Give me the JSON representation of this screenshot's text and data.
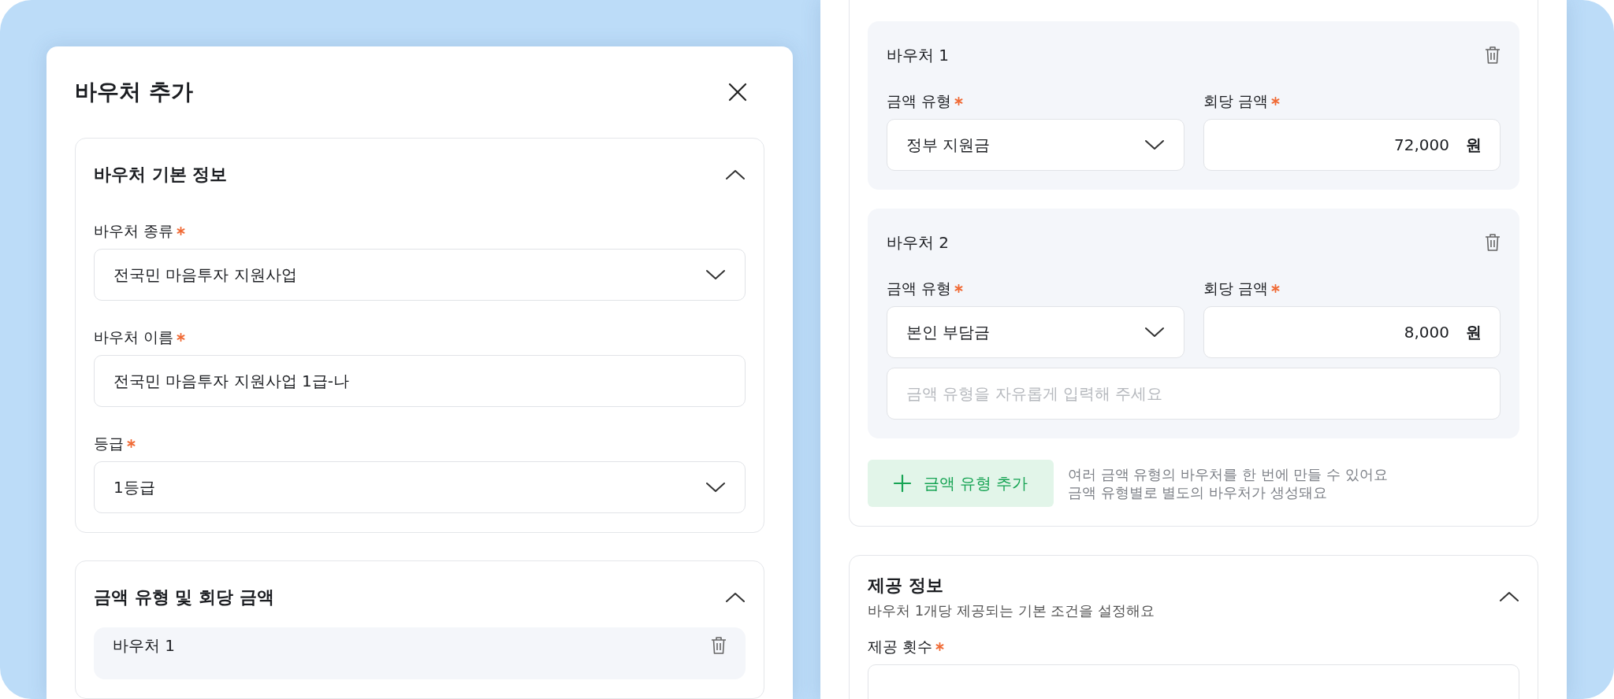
{
  "left_panel": {
    "title": "바우처 추가",
    "sections": [
      {
        "title": "바우처 기본 정보",
        "expanded": true,
        "fields": [
          {
            "label": "바우처 종류",
            "required": true,
            "kind": "select",
            "value": "전국민 마음투자 지원사업"
          },
          {
            "label": "바우처 이름",
            "required": true,
            "kind": "text",
            "value": "전국민 마음투자 지원사업 1급-나"
          },
          {
            "label": "등급",
            "required": true,
            "kind": "select",
            "value": "1등급"
          }
        ]
      },
      {
        "title": "금액 유형 및 회당 금액",
        "expanded": true,
        "vouchers": [
          {
            "title": "바우처 1"
          }
        ]
      }
    ]
  },
  "right_panel": {
    "vouchers": [
      {
        "title": "바우처 1",
        "fields": [
          {
            "label": "금액 유형",
            "required": true,
            "kind": "select",
            "value": "정부 지원금"
          },
          {
            "label": "회당 금액",
            "required": true,
            "kind": "amount",
            "value": "72,000",
            "unit": "원"
          }
        ]
      },
      {
        "title": "바우처 2",
        "fields": [
          {
            "label": "금액 유형",
            "required": true,
            "kind": "select",
            "value": "본인 부담금"
          },
          {
            "label": "회당 금액",
            "required": true,
            "kind": "amount",
            "value": "8,000",
            "unit": "원"
          }
        ],
        "extra_field": {
          "kind": "text",
          "placeholder": "금액 유형을 자유롭게 입력해 주세요"
        }
      }
    ],
    "add_button": "금액 유형 추가",
    "hint_lines": [
      "여러 금액 유형의 바우처를 한 번에 만들 수 있어요",
      "금액 유형별로 별도의 바우처가 생성돼요"
    ],
    "sections": [
      {
        "title": "제공 정보",
        "subtitle": "바우처 1개당 제공되는 기본 조건을 설정해요",
        "expanded": true,
        "fields": [
          {
            "label": "제공 횟수",
            "required": true,
            "kind": "text"
          }
        ]
      }
    ]
  }
}
